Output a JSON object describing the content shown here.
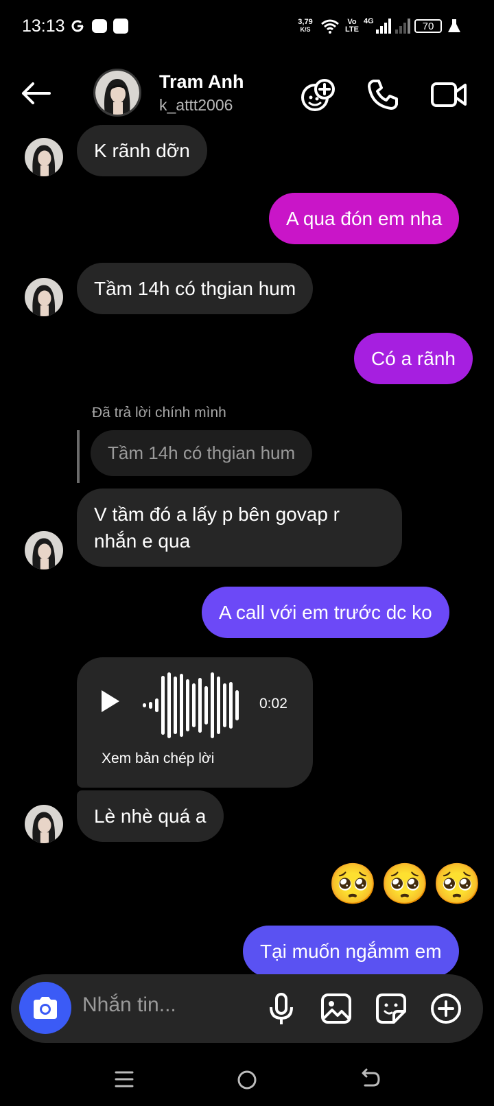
{
  "status_bar": {
    "time": "13:13",
    "net_speed_value": "3,79",
    "net_speed_unit": "K/S",
    "volte_top": "Vo",
    "volte_bottom": "LTE",
    "network": "4G",
    "battery": "70"
  },
  "header": {
    "name": "Tram Anh",
    "username": "k_attt2006"
  },
  "messages": {
    "m1": "K rãnh dỡn",
    "m2": "A qua đón em nha",
    "m3": "Tầm 14h có thgian hum",
    "m4": "Có a rãnh",
    "reply_label": "Đã trả lời chính mình",
    "reply_quote": "Tầm 14h có thgian hum",
    "m5_line1": "V tầm đó a lấy p bên govap r",
    "m5_line2": "nhắn e qua",
    "m6": "A call với em trước dc ko",
    "voice_duration": "0:02",
    "voice_transcript": "Xem bản chép lời",
    "m7": "Lè nhè quá a",
    "m8_emoji": "🥺🥺🥺",
    "m9": "Tại muốn ngắmm em"
  },
  "composer": {
    "placeholder": "Nhắn tin..."
  },
  "colors": {
    "incoming_bubble": "#262626",
    "m2": "#c915c8",
    "m4": "#a61fe0",
    "m6": "#6c49f7",
    "m9": "#5a52f2",
    "camera_button": "#3b5bf6"
  }
}
